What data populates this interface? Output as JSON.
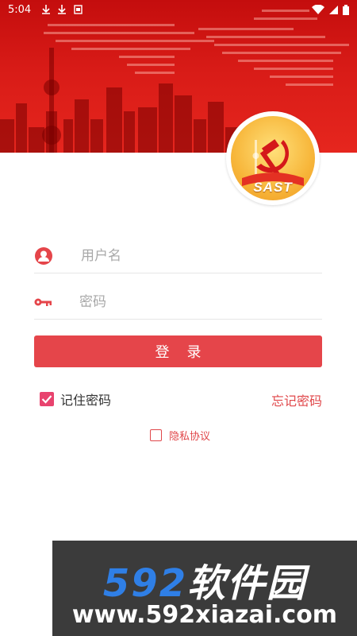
{
  "status_bar": {
    "time": "5:04"
  },
  "login": {
    "username_placeholder": "用户名",
    "password_placeholder": "密码",
    "submit_label": "登录",
    "remember_label": "记住密码",
    "remember_checked": true,
    "forgot_label": "忘记密码",
    "privacy_label": "隐私协议",
    "privacy_checked": false
  },
  "logo": {
    "text": "SAST"
  },
  "watermark": {
    "digits": "592",
    "name": "软件园",
    "url": "www.592xiazai.com"
  },
  "colors": {
    "banner_red": "#d81b17",
    "button_red": "#e5454a",
    "accent_red": "#e0474a",
    "checkbox_pink": "#e8436e",
    "logo_gold": "#f7b63a"
  }
}
